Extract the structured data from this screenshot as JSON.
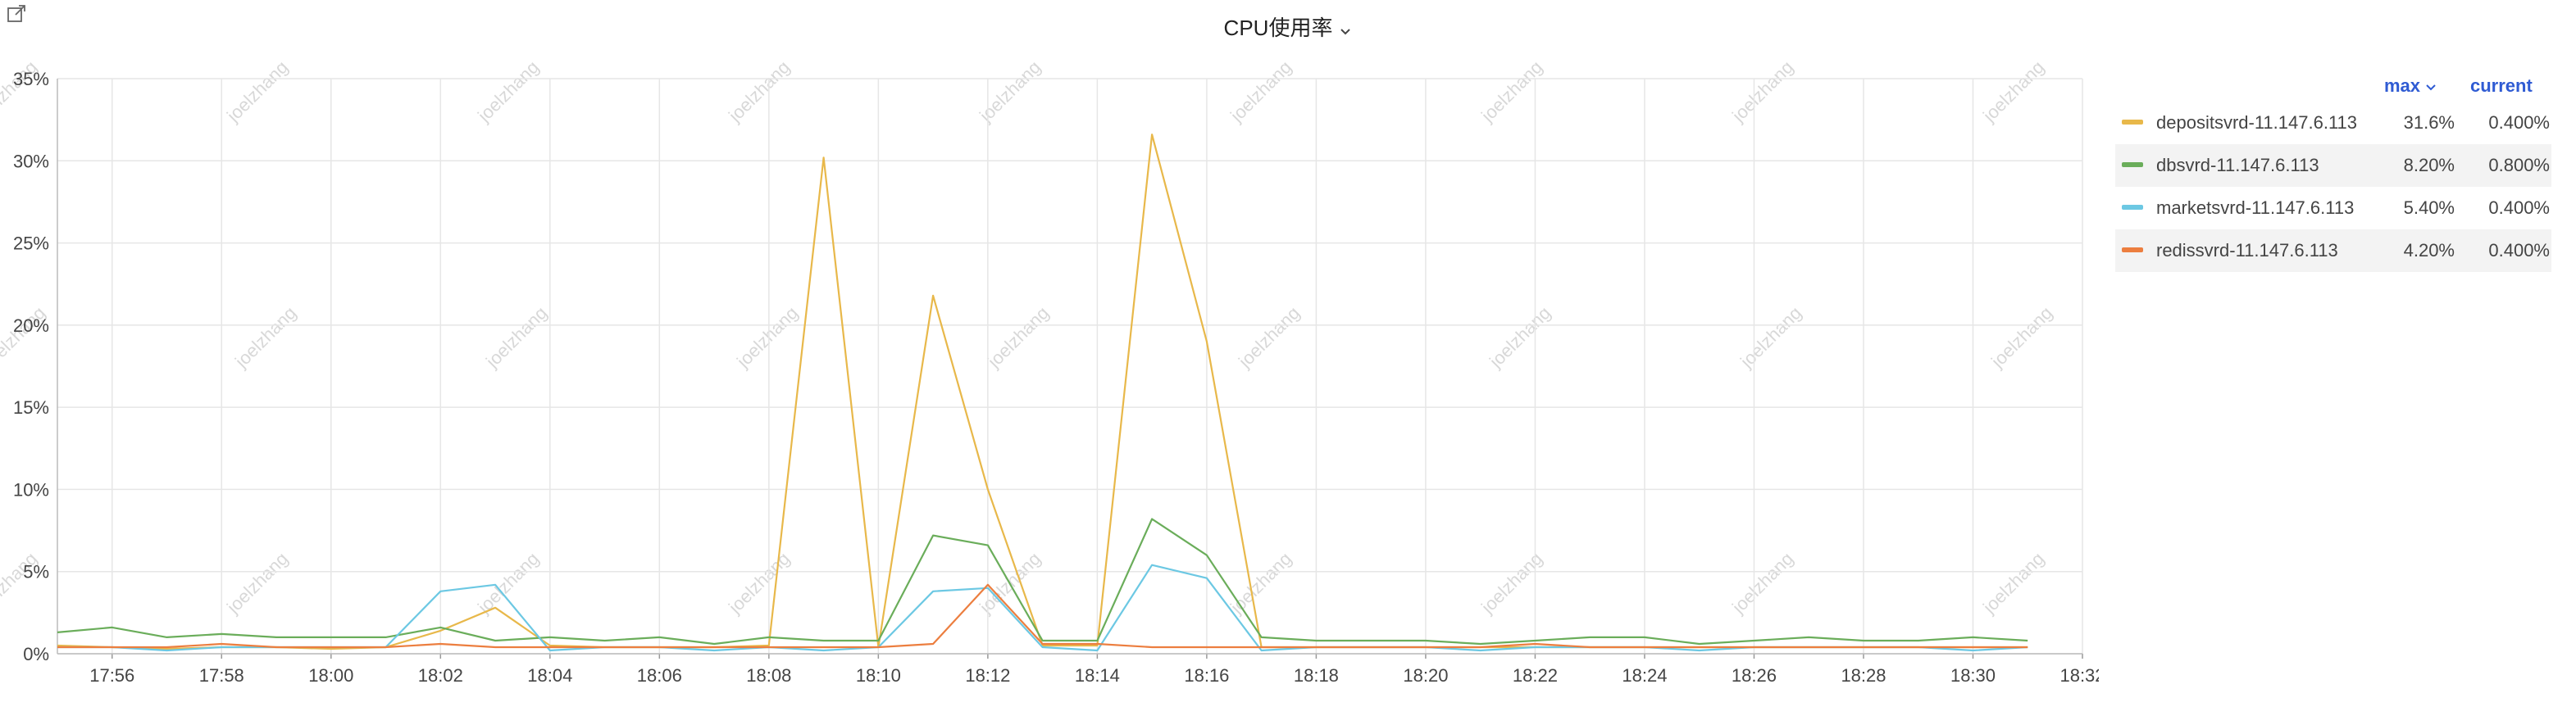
{
  "panel": {
    "title": "CPU使用率",
    "legend_header_max": "max",
    "legend_header_current": "current",
    "watermark_text": "joelzhang"
  },
  "colors": {
    "depositsvrd": "#e8b84a",
    "dbsvrd": "#6aad5a",
    "marketsvrd": "#6cc8e3",
    "redissvrd": "#ec7e3f",
    "header_accent": "#2f5bd3"
  },
  "icons": [
    "external-link-icon",
    "chevron-down-icon"
  ],
  "legend": [
    {
      "name": "depositsvrd-11.147.6.113",
      "max": "31.6%",
      "current": "0.400%",
      "color": "#e8b84a"
    },
    {
      "name": "dbsvrd-11.147.6.113",
      "max": "8.20%",
      "current": "0.800%",
      "color": "#6aad5a"
    },
    {
      "name": "marketsvrd-11.147.6.113",
      "max": "5.40%",
      "current": "0.400%",
      "color": "#6cc8e3"
    },
    {
      "name": "redissvrd-11.147.6.113",
      "max": "4.20%",
      "current": "0.400%",
      "color": "#ec7e3f"
    }
  ],
  "chart_data": {
    "type": "line",
    "title": "CPU使用率",
    "xlabel": "",
    "ylabel": "",
    "y_unit": "%",
    "ylim": [
      0,
      35
    ],
    "yticks": [
      0,
      5,
      10,
      15,
      20,
      25,
      30,
      35
    ],
    "ytick_labels": [
      "0%",
      "5%",
      "10%",
      "15%",
      "20%",
      "25%",
      "30%",
      "35%"
    ],
    "xtick_labels": [
      "17:56",
      "17:58",
      "18:00",
      "18:02",
      "18:04",
      "18:06",
      "18:08",
      "18:10",
      "18:12",
      "18:14",
      "18:16",
      "18:18",
      "18:20",
      "18:22",
      "18:24",
      "18:26",
      "18:28",
      "18:30",
      "18:32"
    ],
    "xrange": [
      "17:55",
      "18:32"
    ],
    "grid": true,
    "legend_position": "right",
    "x": [
      "17:55",
      "17:56",
      "17:57",
      "17:58",
      "17:59",
      "18:00",
      "18:01",
      "18:02",
      "18:03",
      "18:04",
      "18:05",
      "18:06",
      "18:07",
      "18:08",
      "18:09",
      "18:10",
      "18:11",
      "18:12",
      "18:13",
      "18:14",
      "18:15",
      "18:16",
      "18:17",
      "18:18",
      "18:19",
      "18:20",
      "18:21",
      "18:22",
      "18:23",
      "18:24",
      "18:25",
      "18:26",
      "18:27",
      "18:28",
      "18:29",
      "18:30",
      "18:31"
    ],
    "series": [
      {
        "name": "depositsvrd-11.147.6.113",
        "color": "#e8b84a",
        "values": [
          0.5,
          0.4,
          0.3,
          0.4,
          0.4,
          0.3,
          0.4,
          1.4,
          2.8,
          0.5,
          0.4,
          0.4,
          0.4,
          0.5,
          30.2,
          0.4,
          21.8,
          10.0,
          0.5,
          0.5,
          31.6,
          19.0,
          0.4,
          0.4,
          0.4,
          0.4,
          0.4,
          0.4,
          0.4,
          0.4,
          0.4,
          0.4,
          0.4,
          0.4,
          0.4,
          0.4,
          0.4
        ]
      },
      {
        "name": "dbsvrd-11.147.6.113",
        "color": "#6aad5a",
        "values": [
          1.3,
          1.6,
          1.0,
          1.2,
          1.0,
          1.0,
          1.0,
          1.6,
          0.8,
          1.0,
          0.8,
          1.0,
          0.6,
          1.0,
          0.8,
          0.8,
          7.2,
          6.6,
          0.8,
          0.8,
          8.2,
          6.0,
          1.0,
          0.8,
          0.8,
          0.8,
          0.6,
          0.8,
          1.0,
          1.0,
          0.6,
          0.8,
          1.0,
          0.8,
          0.8,
          1.0,
          0.8
        ]
      },
      {
        "name": "marketsvrd-11.147.6.113",
        "color": "#6cc8e3",
        "values": [
          0.4,
          0.4,
          0.2,
          0.4,
          0.4,
          0.4,
          0.4,
          3.8,
          4.2,
          0.2,
          0.4,
          0.4,
          0.2,
          0.4,
          0.2,
          0.4,
          3.8,
          4.0,
          0.4,
          0.2,
          5.4,
          4.6,
          0.2,
          0.4,
          0.4,
          0.4,
          0.2,
          0.4,
          0.4,
          0.4,
          0.2,
          0.4,
          0.4,
          0.4,
          0.4,
          0.2,
          0.4
        ]
      },
      {
        "name": "redissvrd-11.147.6.113",
        "color": "#ec7e3f",
        "values": [
          0.4,
          0.4,
          0.4,
          0.6,
          0.4,
          0.4,
          0.4,
          0.6,
          0.4,
          0.4,
          0.4,
          0.4,
          0.4,
          0.4,
          0.4,
          0.4,
          0.6,
          4.2,
          0.6,
          0.6,
          0.4,
          0.4,
          0.4,
          0.4,
          0.4,
          0.4,
          0.4,
          0.6,
          0.4,
          0.4,
          0.4,
          0.4,
          0.4,
          0.4,
          0.4,
          0.4,
          0.4
        ]
      }
    ]
  }
}
